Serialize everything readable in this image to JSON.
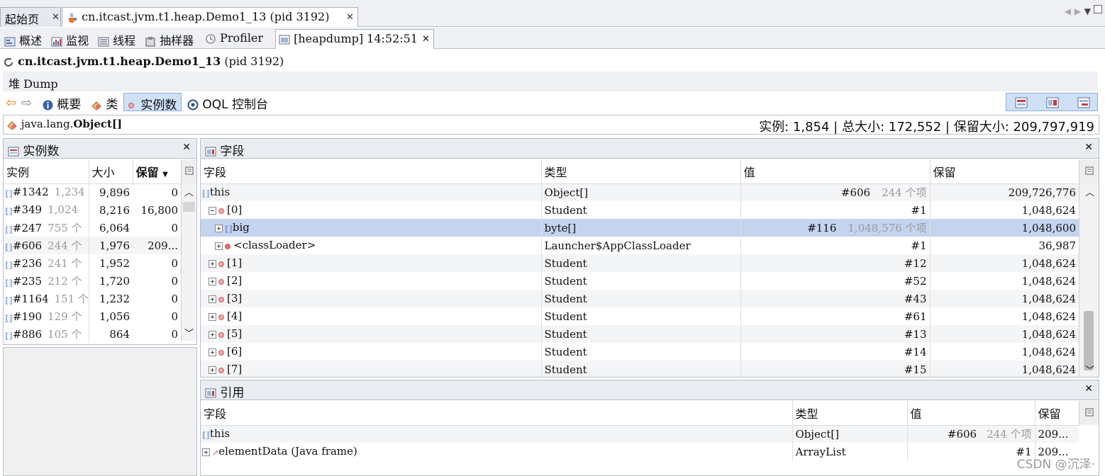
{
  "tabs": {
    "start": "起始页",
    "main": "cn.itcast.jvm.t1.heap.Demo1_13 (pid 3192)"
  },
  "subtabs": [
    "概述",
    "监视",
    "线程",
    "抽样器",
    "Profiler",
    "[heapdump] 14:52:51"
  ],
  "app": {
    "title_bold": "cn.itcast.jvm.t1.heap.Demo1_13",
    "title_rest": " (pid 3192)"
  },
  "section": "堆 Dump",
  "toolbar": {
    "summary": "概要",
    "classes": "类",
    "instances": "实例数",
    "oql": "OQL 控制台"
  },
  "classbar": {
    "prefix": "java.lang.",
    "name": "Object[]",
    "stats": "实例: 1,854  |  总大小: 172,552  |  保留大小: 209,797,919"
  },
  "left_panel": {
    "title": "实例数",
    "columns": [
      "实例",
      "大小",
      "保留"
    ],
    "rows": [
      {
        "id": "#1342",
        "count": "1,234",
        "size": "9,896",
        "retained": "0"
      },
      {
        "id": "#349",
        "count": "1,024",
        "size": "8,216",
        "retained": "16,800"
      },
      {
        "id": "#247",
        "count": "755 个",
        "size": "6,064",
        "retained": "0"
      },
      {
        "id": "#606",
        "count": "244 个",
        "size": "1,976",
        "retained": "209..."
      },
      {
        "id": "#236",
        "count": "241 个",
        "size": "1,952",
        "retained": "0"
      },
      {
        "id": "#235",
        "count": "212 个",
        "size": "1,720",
        "retained": "0"
      },
      {
        "id": "#1164",
        "count": "151 个",
        "size": "1,232",
        "retained": "0"
      },
      {
        "id": "#190",
        "count": "129 个",
        "size": "1,056",
        "retained": "0"
      },
      {
        "id": "#886",
        "count": "105 个",
        "size": "864",
        "retained": "0"
      }
    ]
  },
  "fields_panel": {
    "title": "字段",
    "columns": [
      "字段",
      "类型",
      "值",
      "保留"
    ],
    "rows": [
      {
        "name": "this",
        "type": "Object[]",
        "value": "#606",
        "extra": "244 个项",
        "retained": "209,726,776"
      },
      {
        "name": "[0]",
        "type": "Student",
        "value": "#1",
        "extra": "",
        "retained": "1,048,624"
      },
      {
        "name": "big",
        "type": "byte[]",
        "value": "#116",
        "extra": "1,048,576 个项",
        "retained": "1,048,600"
      },
      {
        "name": "<classLoader>",
        "type": "Launcher$AppClassLoader",
        "value": "#1",
        "extra": "",
        "retained": "36,987"
      },
      {
        "name": "[1]",
        "type": "Student",
        "value": "#12",
        "extra": "",
        "retained": "1,048,624"
      },
      {
        "name": "[2]",
        "type": "Student",
        "value": "#52",
        "extra": "",
        "retained": "1,048,624"
      },
      {
        "name": "[3]",
        "type": "Student",
        "value": "#43",
        "extra": "",
        "retained": "1,048,624"
      },
      {
        "name": "[4]",
        "type": "Student",
        "value": "#61",
        "extra": "",
        "retained": "1,048,624"
      },
      {
        "name": "[5]",
        "type": "Student",
        "value": "#13",
        "extra": "",
        "retained": "1,048,624"
      },
      {
        "name": "[6]",
        "type": "Student",
        "value": "#14",
        "extra": "",
        "retained": "1,048,624"
      },
      {
        "name": "[7]",
        "type": "Student",
        "value": "#15",
        "extra": "",
        "retained": "1,048,624"
      }
    ]
  },
  "refs_panel": {
    "title": "引用",
    "columns": [
      "字段",
      "类型",
      "值",
      "保留"
    ],
    "rows": [
      {
        "name": "this",
        "type": "Object[]",
        "value": "#606",
        "extra": "244 个项",
        "retained": "209..."
      },
      {
        "name": "elementData (Java frame)",
        "type": "ArrayList",
        "value": "#1",
        "extra": "",
        "retained": "209..."
      }
    ]
  },
  "watermark": "CSDN @沉泽·"
}
